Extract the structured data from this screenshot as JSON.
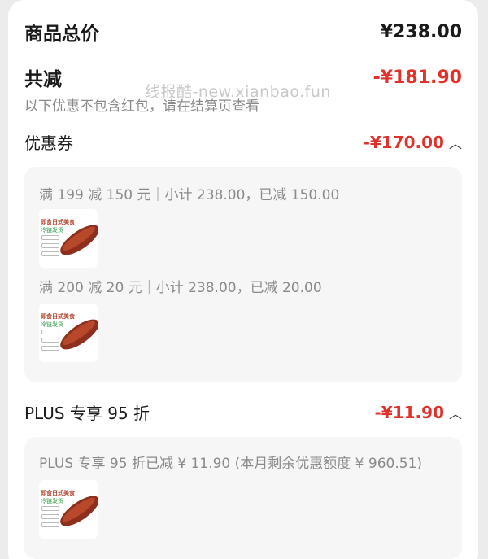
{
  "summary": {
    "total_label": "商品总价",
    "total_value": "¥238.00",
    "reduce_label": "共减",
    "reduce_value": "-¥181.90",
    "note": "以下优惠不包含红包，请在结算页查看",
    "watermark": "线报酷-new.xianbao.fun"
  },
  "coupon": {
    "title": "优惠券",
    "amount": "-¥170.00",
    "rules": [
      {
        "text": "满 199 减 150 元｜小计 238.00，已减 150.00"
      },
      {
        "text": "满 200 减 20 元｜小计 238.00，已减 20.00"
      }
    ]
  },
  "plus": {
    "title": "PLUS 专享 95 折",
    "amount": "-¥11.90",
    "detail": "PLUS 专享 95 折已减 ¥ 11.90 (本月剩余优惠额度 ¥ 960.51)"
  },
  "product_thumb": {
    "line1": "即食日式美食",
    "line2": "冷链发货"
  },
  "colors": {
    "accent": "#e0322a",
    "muted": "#8a8a8a",
    "panel": "#f6f6f6"
  }
}
